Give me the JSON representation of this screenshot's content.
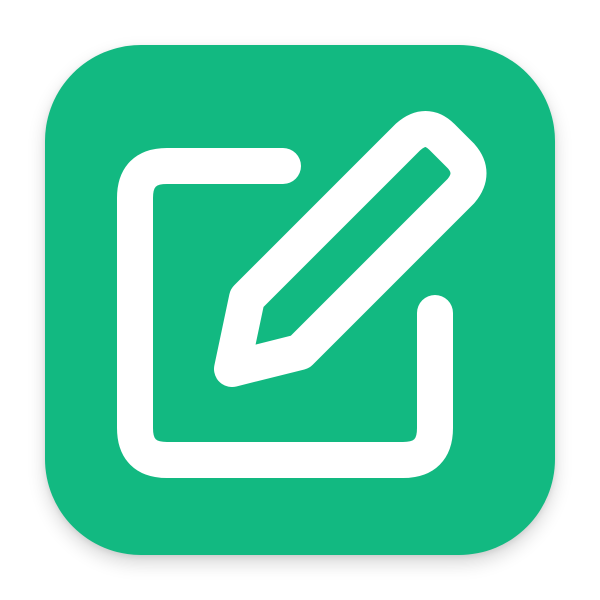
{
  "app_icon": {
    "name": "edit-icon",
    "glyph": "pencil-on-square",
    "colors": {
      "tile_background": "#12b981",
      "glyph_stroke": "#ffffff",
      "page_background": "#ffffff"
    }
  }
}
